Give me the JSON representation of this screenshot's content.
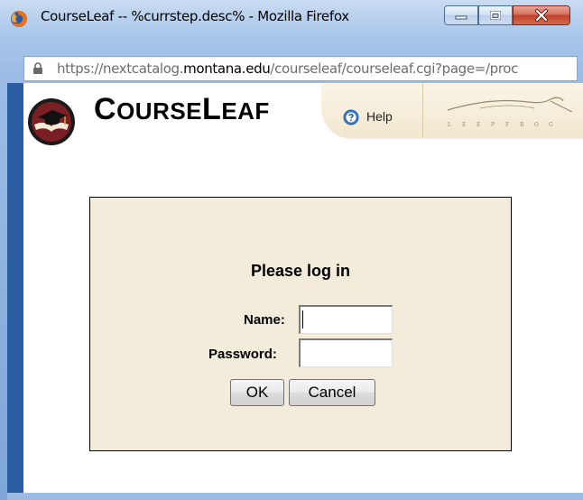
{
  "window": {
    "title": "CourseLeaf -- %currstep.desc% - Mozilla Firefox",
    "app_icon": "firefox-icon",
    "controls": [
      "minimize-icon",
      "maximize-icon",
      "close-icon"
    ]
  },
  "address_bar": {
    "scheme": "https://",
    "subdomain": "nextcatalog.",
    "host": "montana.edu",
    "path": "/courseleaf/courseleaf.cgi?page=/proc",
    "icon": "lock-icon"
  },
  "header": {
    "logo_icon": "courseleaf-logo-icon",
    "brand_c": "C",
    "brand_ourse": "OURSE",
    "brand_l": "L",
    "brand_eaf": "EAF",
    "help_label": "Help",
    "help_icon": "help-icon",
    "partner_logo": "leepfrog-logo"
  },
  "login": {
    "title": "Please log in",
    "name_label": "Name:",
    "name_value": "",
    "password_label": "Password:",
    "password_value": "",
    "ok_label": "OK",
    "cancel_label": "Cancel"
  },
  "colors": {
    "login_bg": "#f3ecdb",
    "header_panel": "#f2e7cf",
    "frame_blue": "#2a5ea0",
    "close_red": "#c0412b"
  }
}
